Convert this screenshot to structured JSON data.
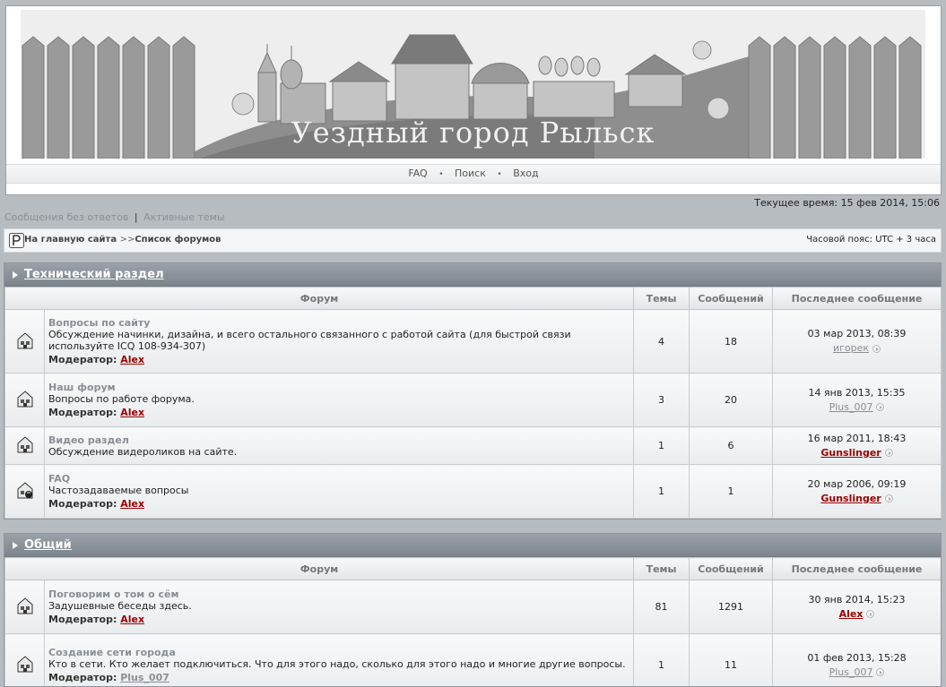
{
  "banner": {
    "title": "Уездный город Рыльск"
  },
  "nav": {
    "faq": "FAQ",
    "search": "Поиск",
    "login": "Вход",
    "separator": "•"
  },
  "current_time": "Текущее время: 15 фев 2014, 15:06",
  "quick_links": {
    "unanswered": "Сообщения без ответов",
    "separator": "|",
    "active": "Активные темы"
  },
  "breadcrumb": {
    "home": "На главную сайта",
    "arrow": ">>",
    "forums": "Список форумов"
  },
  "timezone": "Часовой пояс: UTC + 3 часа",
  "columns": {
    "forum": "Форум",
    "topics": "Темы",
    "posts": "Сообщений",
    "last": "Последнее сообщение"
  },
  "moderator_label": "Модератор:",
  "sections": [
    {
      "title": "Технический раздел",
      "forums": [
        {
          "name": "Вопросы по сайту",
          "desc": "Обсуждение начинки, дизайна, и всего остального связанного с работой сайта (для быстрой связи используйте ICQ 108-934-307)",
          "moderator": "Alex",
          "topics": "4",
          "posts": "18",
          "last_date": "03 мар 2013, 08:39",
          "last_user": "игорек"
        },
        {
          "name": "Наш форум",
          "desc": "Вопросы по работе форума.",
          "moderator": "Alex",
          "topics": "3",
          "posts": "20",
          "last_date": "14 янв 2013, 15:35",
          "last_user": "Plus_007"
        },
        {
          "name": "Видео раздел",
          "desc": "Обсуждение видероликов на сайте.",
          "moderator": "",
          "topics": "1",
          "posts": "6",
          "last_date": "16 мар 2011, 18:43",
          "last_user": "Gunslinger"
        },
        {
          "name": "FAQ",
          "desc": "Частозадаваемые вопросы",
          "moderator": "Alex",
          "topics": "1",
          "posts": "1",
          "last_date": "20 мар 2006, 09:19",
          "last_user": "Gunslinger"
        }
      ]
    },
    {
      "title": "Общий",
      "forums": [
        {
          "name": "Поговорим о том о сём",
          "desc": "Задушевные беседы здесь.",
          "moderator": "Alex",
          "topics": "81",
          "posts": "1291",
          "last_date": "30 янв 2014, 15:23",
          "last_user": "Alex"
        },
        {
          "name": "Создание сети города",
          "desc": "Кто в сети. Кто желает подключиться. Что для этого надо, сколько для этого надо и многие другие вопросы.",
          "moderator": "Plus_007",
          "topics": "1",
          "posts": "11",
          "last_date": "01 фев 2013, 15:28",
          "last_user": "Plus_007"
        }
      ]
    }
  ]
}
